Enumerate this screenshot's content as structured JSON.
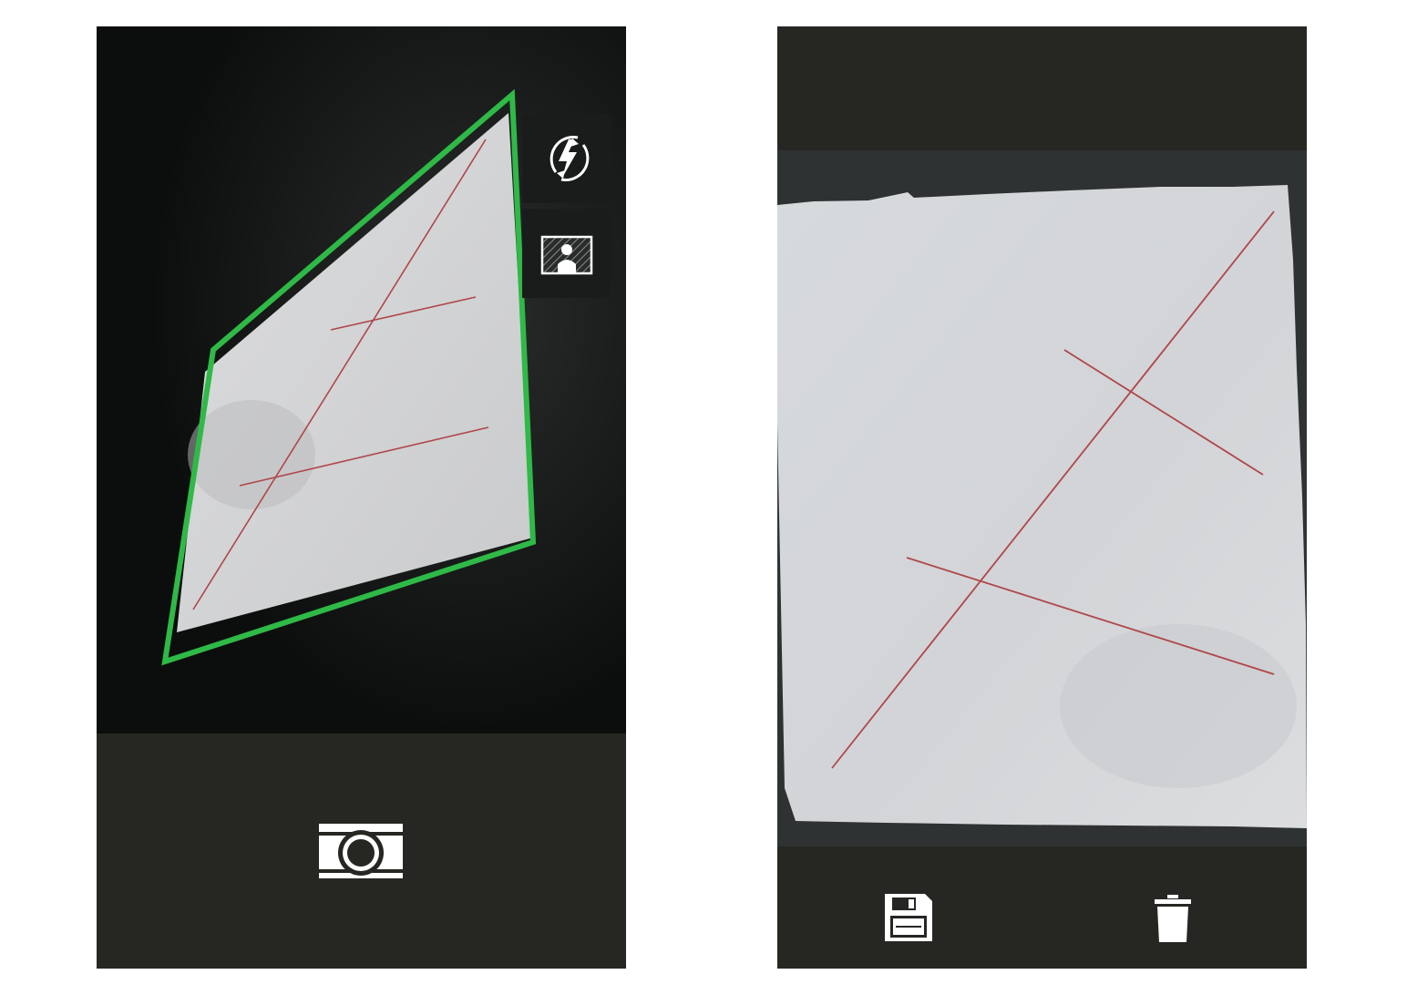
{
  "screens": {
    "camera": {
      "flash_button": {
        "icon": "flash-auto-icon"
      },
      "mode_button": {
        "icon": "portrait-frame-icon"
      },
      "shutter_button": {
        "icon": "camera-icon"
      },
      "detection_outline_color": "#2fb947"
    },
    "preview": {
      "save_button": {
        "icon": "floppy-disk-icon"
      },
      "delete_button": {
        "icon": "trash-icon"
      }
    }
  },
  "colors": {
    "bar_background": "#262723",
    "viewfinder_background": "#0e100f",
    "paper": "#dfe0e2",
    "ink_line": "#b0464a",
    "icon": "#ffffff"
  }
}
